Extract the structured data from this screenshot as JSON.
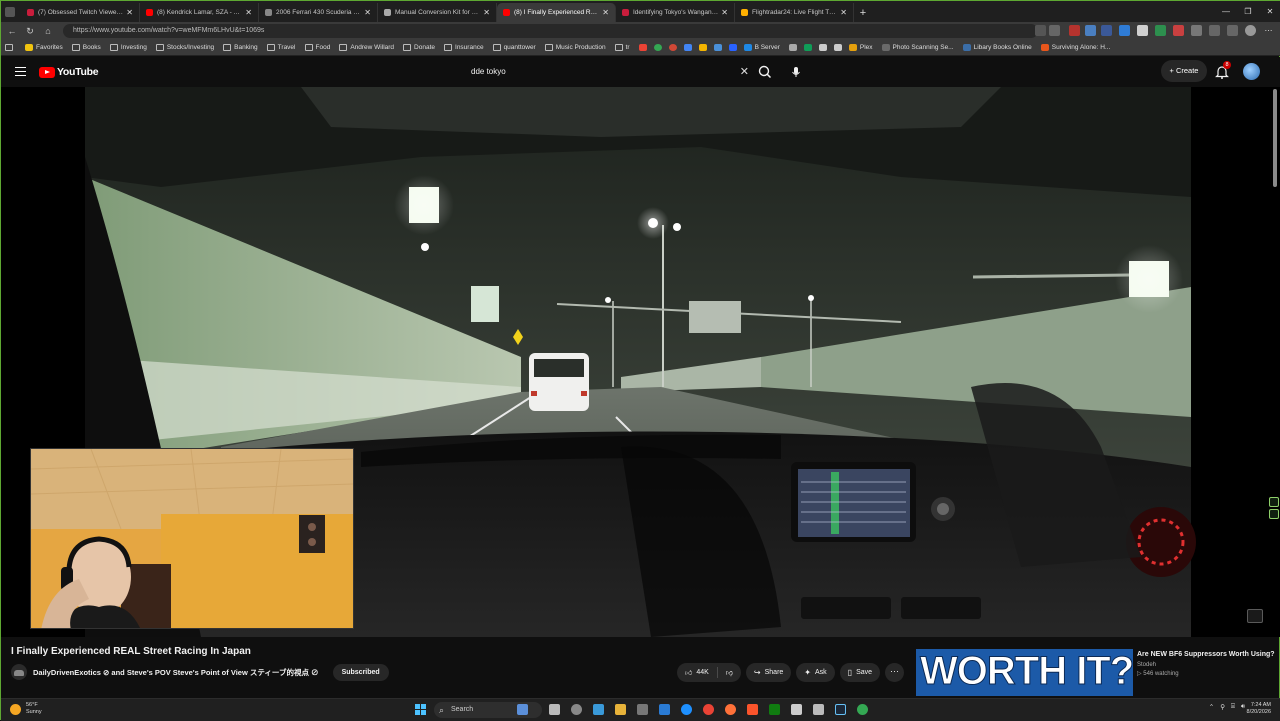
{
  "browser": {
    "tabs": [
      {
        "title": "(7) Obsessed Twitch Viewer Arres",
        "color": "#c91d3c"
      },
      {
        "title": "(8) Kendrick Lamar, SZA - All The",
        "color": "#ff0000"
      },
      {
        "title": "2006 Ferrari 430 Scuderia 6-Speed",
        "color": "#888888"
      },
      {
        "title": "Manual Conversion Kit for Ferrari",
        "color": "#aaaaaa"
      },
      {
        "title": "(8) I Finally Experienced REAL Stree",
        "color": "#ff0000",
        "active": true
      },
      {
        "title": "Identifying Tokyo's Wangan Supers",
        "color": "#c91d3c"
      },
      {
        "title": "Flightradar24: Live Flight Tracker",
        "color": "#ffb000"
      }
    ],
    "close_glyph": "✕",
    "new_tab_glyph": "+",
    "window_controls": [
      "—",
      "❐",
      "✕"
    ],
    "url": "https://www.youtube.com/watch?v=weMFMm6LHvU&t=1069s",
    "bookmarks": [
      "Favorites",
      "Books",
      "Investing",
      "Stocks/Investing",
      "Banking",
      "Travel",
      "Food",
      "Andrew Willard",
      "Donate",
      "Insurance",
      "quanttower",
      "Music Production",
      "tr"
    ],
    "bookmarks_right": [
      "B Server",
      "Plex",
      "Photo Scanning Se...",
      "Libary Books Online",
      "Surviving Alone: H..."
    ]
  },
  "youtube": {
    "logo_text": "YouTube",
    "search_query": "dde tokyo",
    "create_label": "Create",
    "notification_count": "8",
    "video_title": "I Finally Experienced REAL Street Racing In Japan",
    "channel_line": "DailyDrivenExotics ⊘ and Steve's POV Steve's Point of View スティーブ的視点 ⊘",
    "subscribe_label": "Subscribed",
    "likes": "44K",
    "share_label": "Share",
    "ask_label": "Ask",
    "save_label": "Save",
    "more_glyph": "···",
    "recommended": {
      "thumbnail_text": "WORTH IT?",
      "title": "Are NEW BF6 Suppressors Worth Using?",
      "channel": "Stodeh",
      "watching": "546 watching"
    }
  },
  "taskbar": {
    "temp": "56°F",
    "condition": "Sunny",
    "search_label": "Search",
    "time": "7:24 AM",
    "date": "8/20/2026"
  }
}
